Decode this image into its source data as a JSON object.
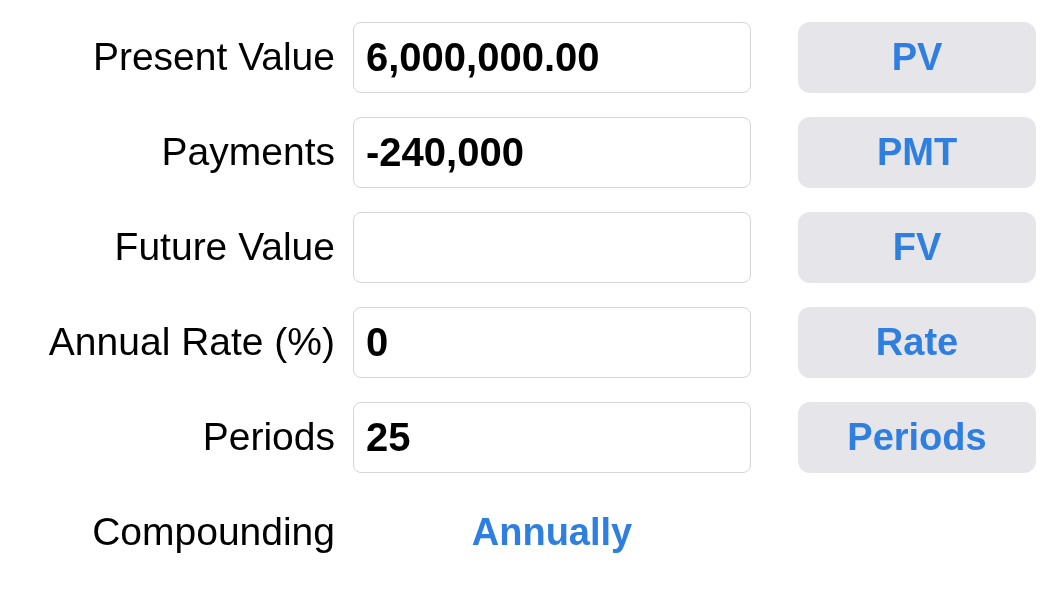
{
  "fields": [
    {
      "label": "Present Value",
      "value": "6,000,000.00",
      "button": "PV"
    },
    {
      "label": "Payments",
      "value": "-240,000",
      "button": "PMT"
    },
    {
      "label": "Future Value",
      "button": "FV"
    },
    {
      "label": "Annual Rate (%)",
      "value": "0",
      "button": "Rate"
    },
    {
      "label": "Periods",
      "value": "25",
      "button": "Periods"
    }
  ],
  "compounding": {
    "label": "Compounding",
    "value": "Annually"
  }
}
